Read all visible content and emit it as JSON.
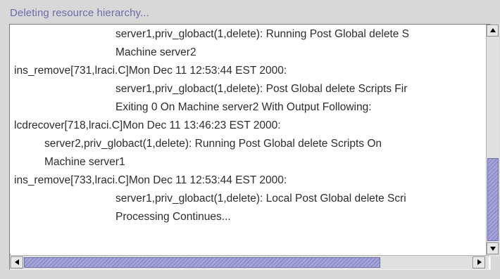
{
  "window": {
    "title": "Deleting resource hierarchy..."
  },
  "log": {
    "lines": [
      "server1,priv_globact(1,delete): Running Post Global delete S",
      "Machine server2",
      "ins_remove[731,lraci.C]Mon Dec 11 12:53:44 EST 2000:",
      "server1,priv_globact(1,delete): Post Global delete Scripts Fir",
      "Exiting 0 On Machine server2 With Output Following:",
      "lcdrecover[718,lraci.C]Mon Dec 11 13:46:23 EST 2000:",
      "server2,priv_globact(1,delete): Running Post Global delete Scripts On",
      "Machine server1",
      "ins_remove[733,lraci.C]Mon Dec 11 12:53:44 EST 2000:",
      "server1,priv_globact(1,delete): Local Post Global delete Scri",
      "Processing Continues..."
    ]
  },
  "scrollbars": {
    "icons": {
      "up": "arrow-up-icon",
      "down": "arrow-down-icon",
      "left": "arrow-left-icon",
      "right": "arrow-right-icon"
    },
    "vertical_position": 0.62,
    "horizontal_position": 0.0
  },
  "colors": {
    "title": "#6b6bab",
    "thumb": "#9a9ad2",
    "background": "#d8d8d8"
  }
}
